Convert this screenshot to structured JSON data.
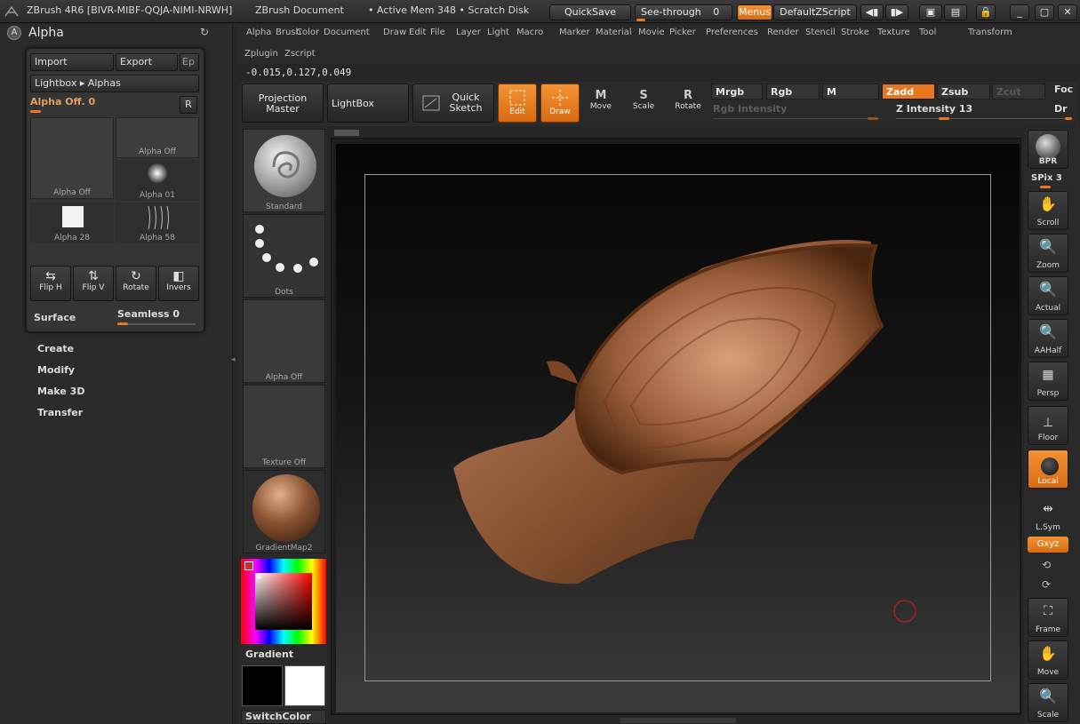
{
  "titlebar": {
    "app_title": "ZBrush 4R6 [BIVR-MIBF-QQJA-NIMI-NRWH]",
    "document": "ZBrush Document",
    "active_mem": "• Active Mem 348 • Scratch Disk",
    "quicksave": "QuickSave",
    "see_through": "See-through",
    "see_through_value": "0",
    "menus": "Menus",
    "default_zscript": "DefaultZScript"
  },
  "menubar": {
    "row1": [
      "Alpha",
      "Brush",
      "Color",
      "Document",
      "Draw",
      "Edit",
      "File",
      "Layer",
      "Light",
      "Macro",
      "Marker",
      "Material",
      "Movie",
      "Picker",
      "Preferences",
      "Render",
      "Stencil",
      "Stroke",
      "Texture",
      "Tool",
      "Transform"
    ],
    "row2": [
      "Zplugin",
      "Zscript"
    ],
    "coords": "-0.015,0.127,0.049"
  },
  "palette": {
    "title": "Alpha",
    "import": "Import",
    "export": "Export",
    "ep": "Ep",
    "lightbox": "Lightbox ▸ Alphas",
    "alpha_off_slider": "Alpha Off. 0",
    "alpha_off_level": 0.0,
    "r": "R",
    "thumbs": [
      "Alpha Off",
      "Alpha Off",
      "Alpha 01",
      "Alpha 28",
      "Alpha 58"
    ],
    "flip_h": "Flip H",
    "flip_v": "Flip V",
    "rotate": "Rotate",
    "invers": "Invers",
    "surface": "Surface",
    "seamless": "Seamless 0",
    "submenus": [
      "Create",
      "Modify",
      "Make 3D",
      "Transfer"
    ]
  },
  "shelf": {
    "projection_master": "Projection Master",
    "lightbox": "LightBox",
    "quick_sketch": "Quick Sketch",
    "edit": "Edit",
    "draw": "Draw",
    "move": "Move",
    "scale": "Scale",
    "rotate": "Rotate",
    "mrgb": "Mrgb",
    "rgb": "Rgb",
    "m": "M",
    "zadd": "Zadd",
    "zsub": "Zsub",
    "zcut": "Zcut",
    "focal": "Foc",
    "rgb_intensity": "Rgb Intensity",
    "z_intensity": "Z Intensity 13",
    "draw_size": "Dr"
  },
  "tray": {
    "standard": "Standard",
    "dots": "Dots",
    "alpha_off": "Alpha Off",
    "texture_off": "Texture Off",
    "material": "GradientMap2",
    "gradient": "Gradient",
    "switchcolor": "SwitchColor"
  },
  "rightshelf": {
    "bpr": "BPR",
    "spix": "SPix 3",
    "scroll": "Scroll",
    "zoom": "Zoom",
    "actual": "Actual",
    "aahalf": "AAHalf",
    "persp": "Persp",
    "floor": "Floor",
    "local": "Local",
    "lsym": "L.Sym",
    "xyz": "Gxyz",
    "frame": "Frame",
    "move": "Move",
    "scale": "Scale"
  },
  "colors": {
    "accent": "#e8761f",
    "wood": "#8a5332"
  }
}
